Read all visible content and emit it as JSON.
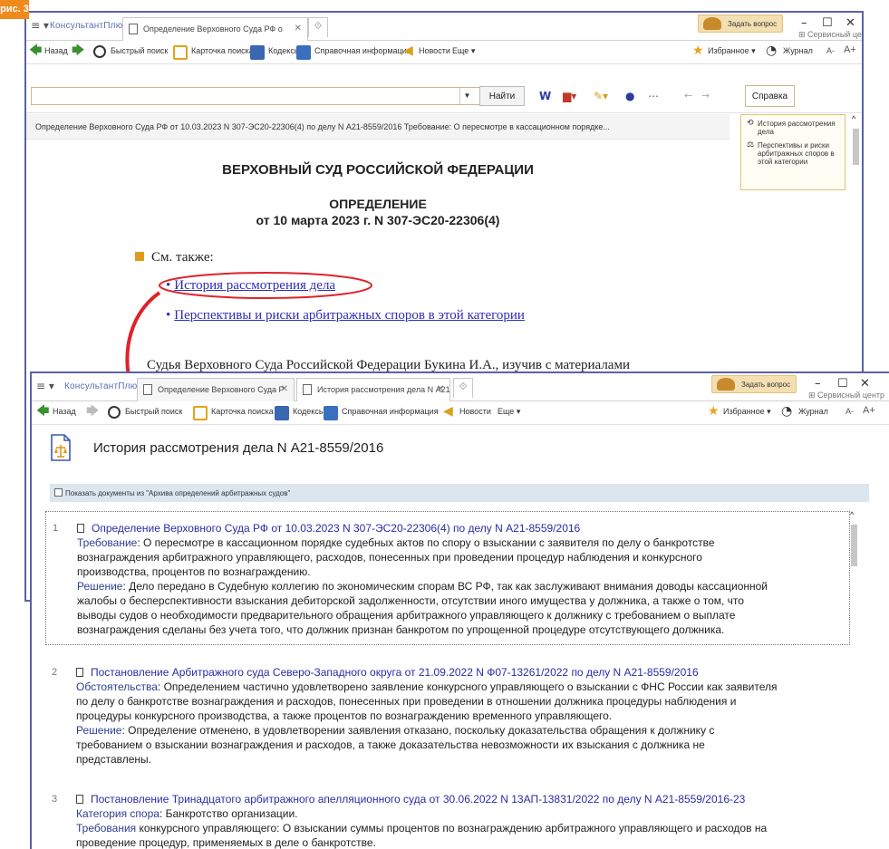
{
  "figure_label": "рис. 3",
  "colors": {
    "accent": "#ef8a1d",
    "window_border": "#5b62a6",
    "link": "#2d2db8",
    "highlight_ellipse": "#e0222a",
    "arrow": "#e0222a"
  },
  "back_window": {
    "brand": "КонсультантПлюс",
    "tabs": [
      {
        "label": "Определение Верховного Суда РФ о"
      }
    ],
    "ask_button": "Задать вопрос",
    "service_center": "Сервисный центр",
    "toolbar": {
      "back": "Назад",
      "quick_search": "Быстрый поиск",
      "search_card": "Карточка поиска",
      "codes": "Кодексы",
      "reference": "Справочная информация",
      "news": "Новости",
      "more": "Еще",
      "favorites": "Избранное",
      "journal": "Журнал",
      "font_minus": "A-",
      "font_plus": "A+"
    },
    "find_button": "Найти",
    "help_button": "Справка",
    "doc_header": "Определение Верховного Суда РФ от 10.03.2023 N 307-ЭС20-22306(4) по делу N А21-8559/2016 Требование: О пересмотре в кассационном порядке...",
    "sidebar": [
      {
        "icon": "history-icon",
        "label": "История рассмотрения дела"
      },
      {
        "icon": "scales-icon",
        "label": "Перспективы и риски арбитражных споров в этой категории"
      }
    ],
    "court": "ВЕРХОВНЫЙ СУД РОССИЙСКОЙ ФЕДЕРАЦИИ",
    "doc_type": "ОПРЕДЕЛЕНИЕ",
    "doc_date": "от 10 марта 2023 г. N 307-ЭС20-22306(4)",
    "see_also": "См. также:",
    "links": [
      "История рассмотрения дела",
      "Перспективы и риски арбитражных споров в этой категории"
    ],
    "paragraph": "Судья Верховного Суда Российской Федерации Букина И.А., изучив с материалами"
  },
  "front_window": {
    "brand": "КонсультантПлюс",
    "tabs": [
      {
        "label": "Определение Верховного Суда Р"
      },
      {
        "label": "История рассмотрения дела N А21-8"
      }
    ],
    "ask_button": "Задать вопрос",
    "service_center": "Сервисный центр",
    "toolbar": {
      "back": "Назад",
      "quick_search": "Быстрый поиск",
      "search_card": "Карточка поиска",
      "codes": "Кодексы",
      "reference": "Справочная информация",
      "news": "Новости",
      "more": "Еще",
      "favorites": "Избранное",
      "journal": "Журнал",
      "font_minus": "A-",
      "font_plus": "A+"
    },
    "title": "История рассмотрения дела N А21-8559/2016",
    "checkbox_label": "Показать документы из \"Архива определений арбитражных судов\"",
    "entries": [
      {
        "num": "1",
        "title": "Определение Верховного Суда РФ от 10.03.2023 N 307-ЭС20-22306(4) по делу N А21-8559/2016",
        "lines": [
          {
            "label": "Требование",
            "text": ": О пересмотре в кассационном порядке судебных актов по спору о взыскании с заявителя по делу о банкротстве"
          },
          {
            "label": "",
            "text": "вознаграждения арбитражного управляющего, расходов, понесенных при проведении процедур наблюдения и конкурсного"
          },
          {
            "label": "",
            "text": "производства, процентов по вознаграждению."
          },
          {
            "label": "Решение",
            "text": ": Дело передано в Судебную коллегию по экономическим спорам ВС РФ, так как заслуживают внимания доводы кассационной"
          },
          {
            "label": "",
            "text": "жалобы о бесперспективности взыскания дебиторской задолженности, отсутствии иного имущества у должника, а также о том, что"
          },
          {
            "label": "",
            "text": "выводы судов о необходимости предварительного обращения арбитражного управляющего к должнику с требованием о выплате"
          },
          {
            "label": "",
            "text": "вознаграждения сделаны без учета того, что должник признан банкротом по упрощенной процедуре отсутствующего должника."
          }
        ]
      },
      {
        "num": "2",
        "title": "Постановление Арбитражного суда Северо-Западного округа от 21.09.2022 N Ф07-13261/2022 по делу N А21-8559/2016",
        "lines": [
          {
            "label": "Обстоятельства",
            "text": ": Определением частично удовлетворено заявление конкурсного управляющего о взыскании с ФНС России как заявителя"
          },
          {
            "label": "",
            "text": "по делу о банкротстве вознаграждения и расходов, понесенных при проведении в отношении должника процедуры наблюдения и"
          },
          {
            "label": "",
            "text": "процедуры конкурсного производства, а также процентов по вознаграждению временного управляющего."
          },
          {
            "label": "Решение",
            "text": ": Определение отменено, в удовлетворении заявления отказано, поскольку доказательства обращения к должнику с"
          },
          {
            "label": "",
            "text": "требованием о взыскании вознаграждения и расходов, а также доказательства невозможности их взыскания с должника не"
          },
          {
            "label": "",
            "text": "представлены."
          }
        ]
      },
      {
        "num": "3",
        "title": "Постановление Тринадцатого арбитражного апелляционного суда от 30.06.2022 N 13АП-13831/2022 по делу N А21-8559/2016-23",
        "lines": [
          {
            "label": "Категория спора",
            "text": ": Банкротство организации."
          },
          {
            "label": "Требования",
            "text": " конкурсного управляющего: О взыскании суммы процентов по вознаграждению арбитражного управляющего и расходов на"
          },
          {
            "label": "",
            "text": "проведение процедур, применяемых в деле о банкротстве."
          }
        ]
      }
    ]
  }
}
